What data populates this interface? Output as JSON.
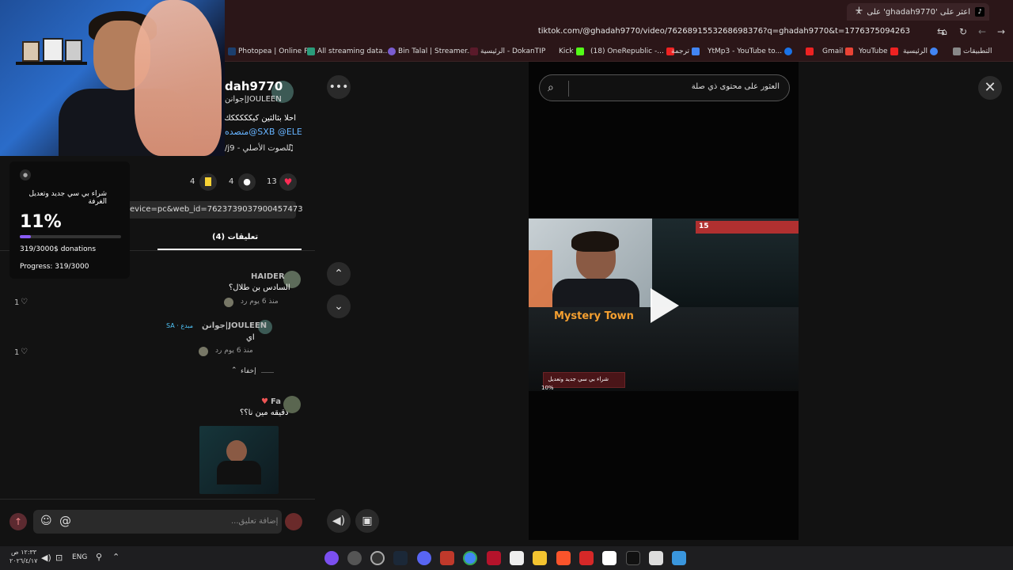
{
  "browser": {
    "tab_title": "اعثر على 'ghadah9770' على",
    "url": "tiktok.com/@ghadah9770/video/7626891553268698376?q=ghadah9770&t=1776375094263",
    "new_tab": "+",
    "close_tab": "×",
    "bookmarks": [
      "Photopea | Online P...",
      "All streaming data...",
      "Bin Talal | Streamer...",
      "الرئيسية - DokanTIP",
      "Kick",
      "(18) OneRepublic -...",
      "ترجمة",
      "YtMp3 - YouTube to...",
      "Gmail",
      "YouTube",
      "الرئيسية",
      "التطبيقات"
    ]
  },
  "donation": {
    "title": "شراء بي سي جديد وتعديل الغرفة",
    "percent_label": "11%",
    "progress": 0.11,
    "donations": "319/3000$ donations",
    "progress_text": "Progress: 319/3000"
  },
  "post": {
    "username": "ghadah9770",
    "username_partial": "dah9770",
    "display_name": "جوانن|JOULEEN",
    "display_name_partial": "جوانن|JOULEEN",
    "caption_line1": "احلا بثالثين كيكككككك( مـ",
    "caption_line2": "متصده@SXB @ELE",
    "sound": "الصوت الأصلي - j9/",
    "link": "evice=pc&web_id=7623739037900457473",
    "likes": "13",
    "comments": "4",
    "saves": "4",
    "comments_tab": "تعليقات (4)"
  },
  "comments": [
    {
      "user": "HAIDER",
      "text": "السادس بن طلال؟",
      "meta": "منذ 6 يوم   رد",
      "likes": "1"
    },
    {
      "user": "جوانن|JOULEEN",
      "badge": "SA · مبدع",
      "text": "اي",
      "meta": "منذ 6 يوم   رد",
      "likes": "1"
    },
    {
      "collapse": "إخفاء"
    },
    {
      "user": "Fa",
      "text": "دقيقه مين نا؟؟"
    }
  ],
  "comment_input": {
    "placeholder": "إضافة تعليق...",
    "at": "@"
  },
  "search": {
    "placeholder": "العثور على محتوى ذي صلة"
  },
  "video": {
    "overlay_text": "Mystery Town",
    "hud_number": "15",
    "bottom_label": "شراء بي سي جديد وتعديل",
    "bottom_percent": "10%"
  },
  "taskbar": {
    "time": "١٢:٣٣ ص",
    "date": "٢٠٢٦/٤/١٧",
    "lang": "ENG"
  },
  "colors": {
    "accent_pink": "#fe2c55",
    "progress_purple": "#8a5cf6",
    "mystery_orange": "#f5a030"
  }
}
